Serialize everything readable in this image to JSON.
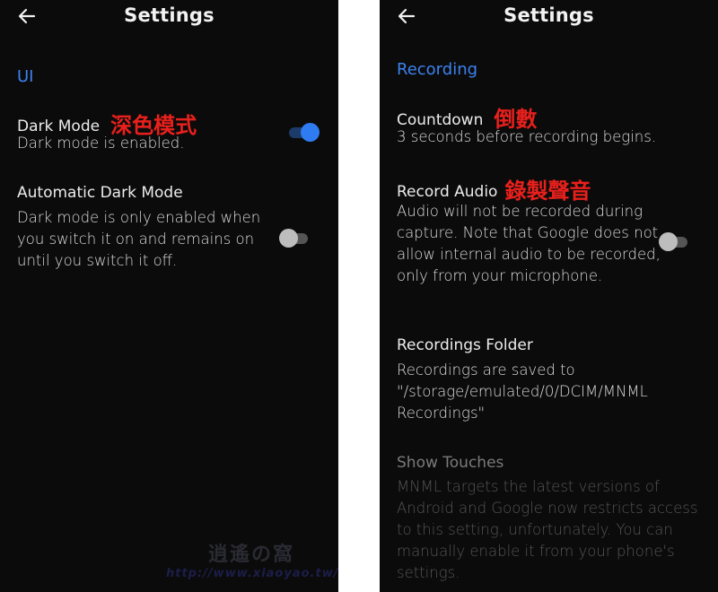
{
  "left_screen": {
    "header": {
      "title": "Settings",
      "back_icon": "arrow-left-icon"
    },
    "section": "UI",
    "items": [
      {
        "title": "Dark Mode",
        "annotation": "深色模式",
        "description": "Dark mode is enabled.",
        "toggle": true
      },
      {
        "title": "Automatic Dark Mode",
        "description": "Dark mode is only enabled when you switch it on and remains on until you switch it off.",
        "toggle": false
      }
    ],
    "watermark": {
      "logo": "逍遙の窩",
      "url": "http://www.xiaoyao.tw/"
    }
  },
  "right_screen": {
    "header": {
      "title": "Settings",
      "back_icon": "arrow-left-icon"
    },
    "section": "Recording",
    "items": [
      {
        "title": "Countdown",
        "annotation": "倒數",
        "description": "3 seconds before recording begins."
      },
      {
        "title": "Record Audio",
        "annotation": "錄製聲音",
        "description": "Audio will not be recorded during capture. Note that Google does not allow internal audio to be recorded, only from your microphone.",
        "toggle": false
      },
      {
        "title": "Recordings Folder",
        "description": "Recordings are saved to \"/storage/emulated/0/DCIM/MNML Recordings\""
      },
      {
        "title": "Show Touches",
        "description": "MNML targets the latest versions of Android and Google now restricts access to this setting, unfortunately. You can manually enable it from your phone's settings.",
        "disabled": true
      }
    ]
  },
  "colors": {
    "background": "#0b0b0b",
    "accent": "#3d82f0",
    "annotation": "#e8201c",
    "toggle_on": "#2f7bf2",
    "toggle_off": "#bdbdbd"
  }
}
